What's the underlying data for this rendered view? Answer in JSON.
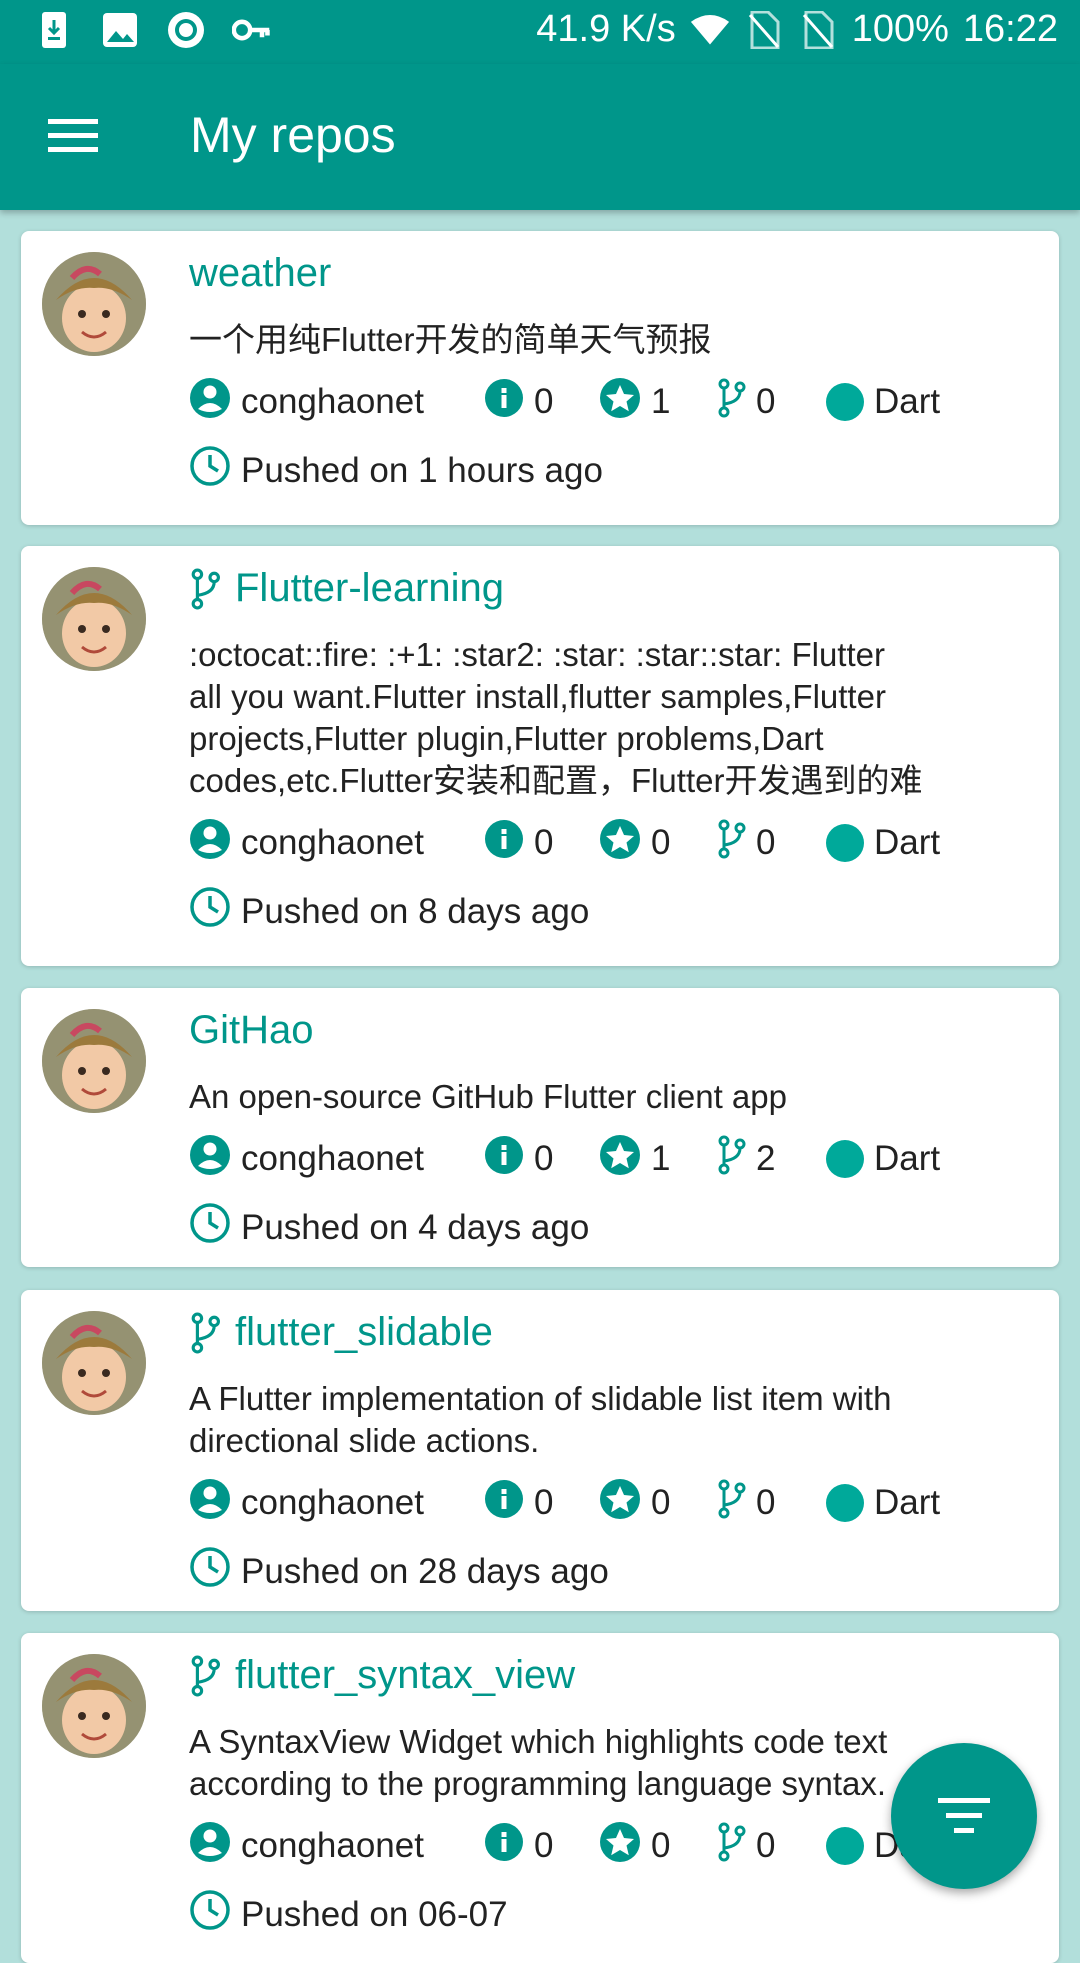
{
  "status_bar": {
    "network_speed": "41.9 K/s",
    "battery": "100%",
    "time": "16:22",
    "left_icons": [
      "download-icon",
      "image-icon",
      "record-icon",
      "key-icon"
    ],
    "right_icons": [
      "wifi-icon",
      "no-sim-icon",
      "no-sim-icon"
    ]
  },
  "appbar": {
    "title": "My repos",
    "menu_icon": "menu-icon"
  },
  "colors": {
    "primary": "#00968A",
    "background": "#B2DFDB",
    "language_dot": "#00A99A"
  },
  "repos": [
    {
      "name": "weather",
      "forked": false,
      "description_lines": [
        "一个用纯Flutter开发的简单天气预报"
      ],
      "owner": "conghaonet",
      "issues": "0",
      "stars": "1",
      "forks": "0",
      "language": "Dart",
      "pushed": "Pushed on 1 hours ago"
    },
    {
      "name": "Flutter-learning",
      "forked": true,
      "description_lines": [
        ":octocat::fire: :+1:  :star2:  :star: :star::star: Flutter",
        "all you want.Flutter install,flutter samples,Flutter",
        "projects,Flutter plugin,Flutter problems,Dart",
        "codes,etc.Flutter安装和配置，Flutter开发遇到的难"
      ],
      "owner": "conghaonet",
      "issues": "0",
      "stars": "0",
      "forks": "0",
      "language": "Dart",
      "pushed": "Pushed on 8 days ago"
    },
    {
      "name": "GitHao",
      "forked": false,
      "description_lines": [
        "An open-source GitHub Flutter client app"
      ],
      "owner": "conghaonet",
      "issues": "0",
      "stars": "1",
      "forks": "2",
      "language": "Dart",
      "pushed": "Pushed on 4 days ago"
    },
    {
      "name": "flutter_slidable",
      "forked": true,
      "description_lines": [
        "A Flutter implementation of slidable list item with",
        "directional slide actions."
      ],
      "owner": "conghaonet",
      "issues": "0",
      "stars": "0",
      "forks": "0",
      "language": "Dart",
      "pushed": "Pushed on 28 days ago"
    },
    {
      "name": "flutter_syntax_view",
      "forked": true,
      "description_lines": [
        "A SyntaxView Widget which highlights code text",
        "according to the programming language syntax."
      ],
      "owner": "conghaonet",
      "issues": "0",
      "stars": "0",
      "forks": "0",
      "language": "Dart",
      "pushed": "Pushed on 06-07"
    }
  ],
  "fab": {
    "icon": "sort-icon"
  }
}
